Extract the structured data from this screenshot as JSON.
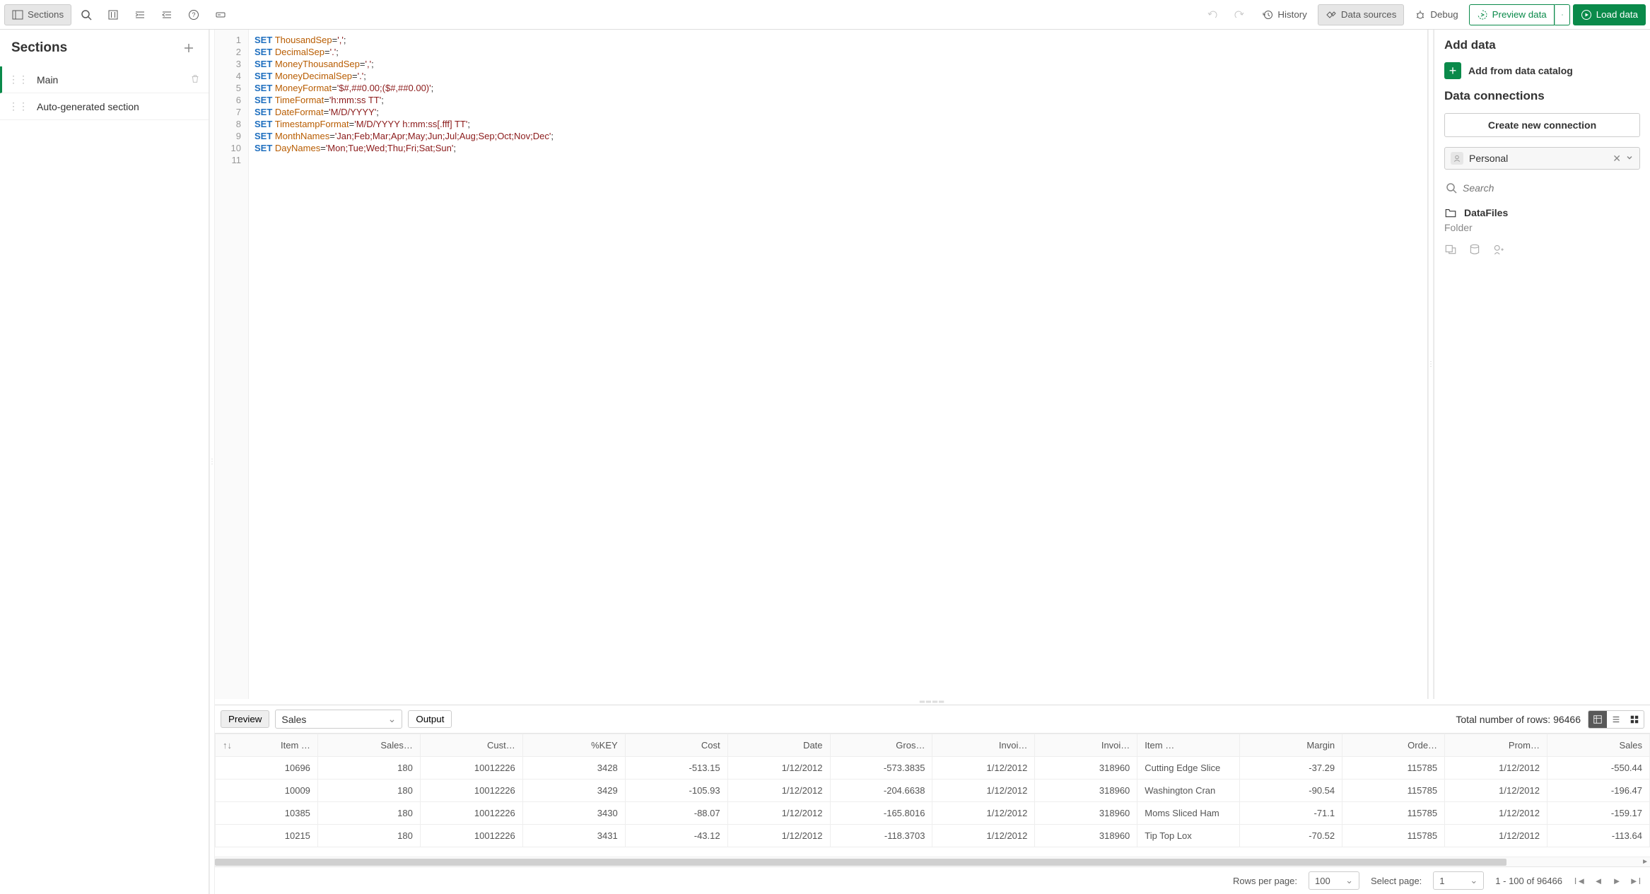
{
  "toolbar": {
    "sections_label": "Sections",
    "history_label": "History",
    "datasources_label": "Data sources",
    "debug_label": "Debug",
    "preview_label": "Preview data",
    "load_label": "Load data"
  },
  "sections_panel": {
    "title": "Sections",
    "items": [
      {
        "label": "Main",
        "selected": true,
        "deletable": true
      },
      {
        "label": "Auto-generated section",
        "selected": false,
        "deletable": false
      }
    ]
  },
  "editor": {
    "lines": [
      {
        "n": "1",
        "kw": "SET",
        "var": "ThousandSep",
        "val": "','"
      },
      {
        "n": "2",
        "kw": "SET",
        "var": "DecimalSep",
        "val": "'.'"
      },
      {
        "n": "3",
        "kw": "SET",
        "var": "MoneyThousandSep",
        "val": "','"
      },
      {
        "n": "4",
        "kw": "SET",
        "var": "MoneyDecimalSep",
        "val": "'.'"
      },
      {
        "n": "5",
        "kw": "SET",
        "var": "MoneyFormat",
        "val": "'$#,##0.00;($#,##0.00)'"
      },
      {
        "n": "6",
        "kw": "SET",
        "var": "TimeFormat",
        "val": "'h:mm:ss TT'"
      },
      {
        "n": "7",
        "kw": "SET",
        "var": "DateFormat",
        "val": "'M/D/YYYY'"
      },
      {
        "n": "8",
        "kw": "SET",
        "var": "TimestampFormat",
        "val": "'M/D/YYYY h:mm:ss[.fff] TT'"
      },
      {
        "n": "9",
        "kw": "SET",
        "var": "MonthNames",
        "val": "'Jan;Feb;Mar;Apr;May;Jun;Jul;Aug;Sep;Oct;Nov;Dec'"
      },
      {
        "n": "10",
        "kw": "SET",
        "var": "DayNames",
        "val": "'Mon;Tue;Wed;Thu;Fri;Sat;Sun'"
      },
      {
        "n": "11",
        "kw": "",
        "var": "",
        "val": ""
      }
    ]
  },
  "right_panel": {
    "add_data_title": "Add data",
    "add_catalog_label": "Add from data catalog",
    "connections_title": "Data connections",
    "create_connection_label": "Create new connection",
    "selected_connection": "Personal",
    "search_placeholder": "Search",
    "folder_name": "DataFiles",
    "folder_sub": "Folder"
  },
  "preview": {
    "tab_preview": "Preview",
    "tab_output": "Output",
    "table_selected": "Sales",
    "total_rows_label": "Total number of rows: 96466",
    "columns": [
      {
        "label": "Item …",
        "align": "right",
        "sort": true
      },
      {
        "label": "Sales…",
        "align": "right"
      },
      {
        "label": "Cust…",
        "align": "right"
      },
      {
        "label": "%KEY",
        "align": "right"
      },
      {
        "label": "Cost",
        "align": "right"
      },
      {
        "label": "Date",
        "align": "right"
      },
      {
        "label": "Gros…",
        "align": "right"
      },
      {
        "label": "Invoi…",
        "align": "right"
      },
      {
        "label": "Invoi…",
        "align": "right"
      },
      {
        "label": "Item …",
        "align": "left"
      },
      {
        "label": "Margin",
        "align": "right"
      },
      {
        "label": "Orde…",
        "align": "right"
      },
      {
        "label": "Prom…",
        "align": "right"
      },
      {
        "label": "Sales",
        "align": "right"
      }
    ],
    "rows": [
      [
        "10696",
        "180",
        "10012226",
        "3428",
        "-513.15",
        "1/12/2012",
        "-573.3835",
        "1/12/2012",
        "318960",
        "Cutting Edge Slice",
        "-37.29",
        "115785",
        "1/12/2012",
        "-550.44"
      ],
      [
        "10009",
        "180",
        "10012226",
        "3429",
        "-105.93",
        "1/12/2012",
        "-204.6638",
        "1/12/2012",
        "318960",
        "Washington Cran",
        "-90.54",
        "115785",
        "1/12/2012",
        "-196.47"
      ],
      [
        "10385",
        "180",
        "10012226",
        "3430",
        "-88.07",
        "1/12/2012",
        "-165.8016",
        "1/12/2012",
        "318960",
        "Moms Sliced Ham",
        "-71.1",
        "115785",
        "1/12/2012",
        "-159.17"
      ],
      [
        "10215",
        "180",
        "10012226",
        "3431",
        "-43.12",
        "1/12/2012",
        "-118.3703",
        "1/12/2012",
        "318960",
        "Tip Top Lox",
        "-70.52",
        "115785",
        "1/12/2012",
        "-113.64"
      ]
    ]
  },
  "pager": {
    "rows_per_page_label": "Rows per page:",
    "rows_per_page_value": "100",
    "select_page_label": "Select page:",
    "select_page_value": "1",
    "range_label": "1 - 100 of 96466"
  }
}
